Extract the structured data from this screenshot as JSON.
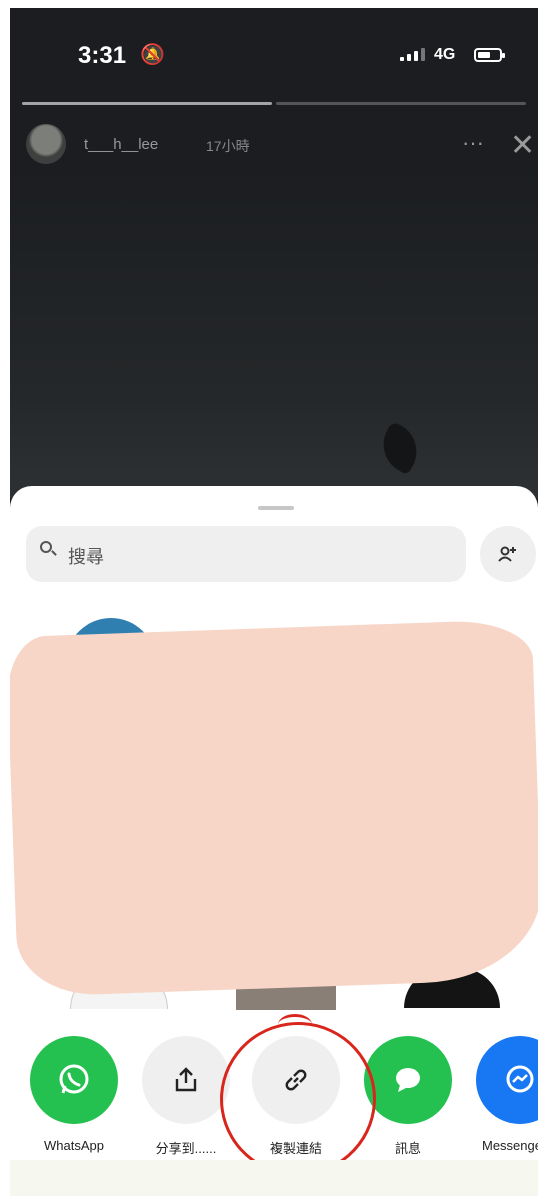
{
  "status_bar": {
    "time": "3:31",
    "mute_icon": "bell-slash-icon",
    "network": "4G"
  },
  "story": {
    "username": "t___h__lee",
    "time_ago": "17小時",
    "more_icon": "more-dots-icon",
    "close_icon": "close-icon"
  },
  "share_sheet": {
    "search_placeholder": "搜尋",
    "group_icon": "add-group-icon",
    "actions": [
      {
        "label": "WhatsApp",
        "icon": "whatsapp-icon",
        "color": "#25c150"
      },
      {
        "label": "分享到......",
        "icon": "share-upload-icon",
        "color": "#efefef"
      },
      {
        "label": "複製連結",
        "icon": "link-icon",
        "color": "#efefef"
      },
      {
        "label": "訊息",
        "icon": "message-bubble-icon",
        "color": "#25c150"
      },
      {
        "label": "Messenger",
        "icon": "messenger-icon",
        "color": "#1877f2"
      }
    ]
  },
  "colors": {
    "annotation": "#d9261c",
    "redaction": "#f7d6c8"
  }
}
